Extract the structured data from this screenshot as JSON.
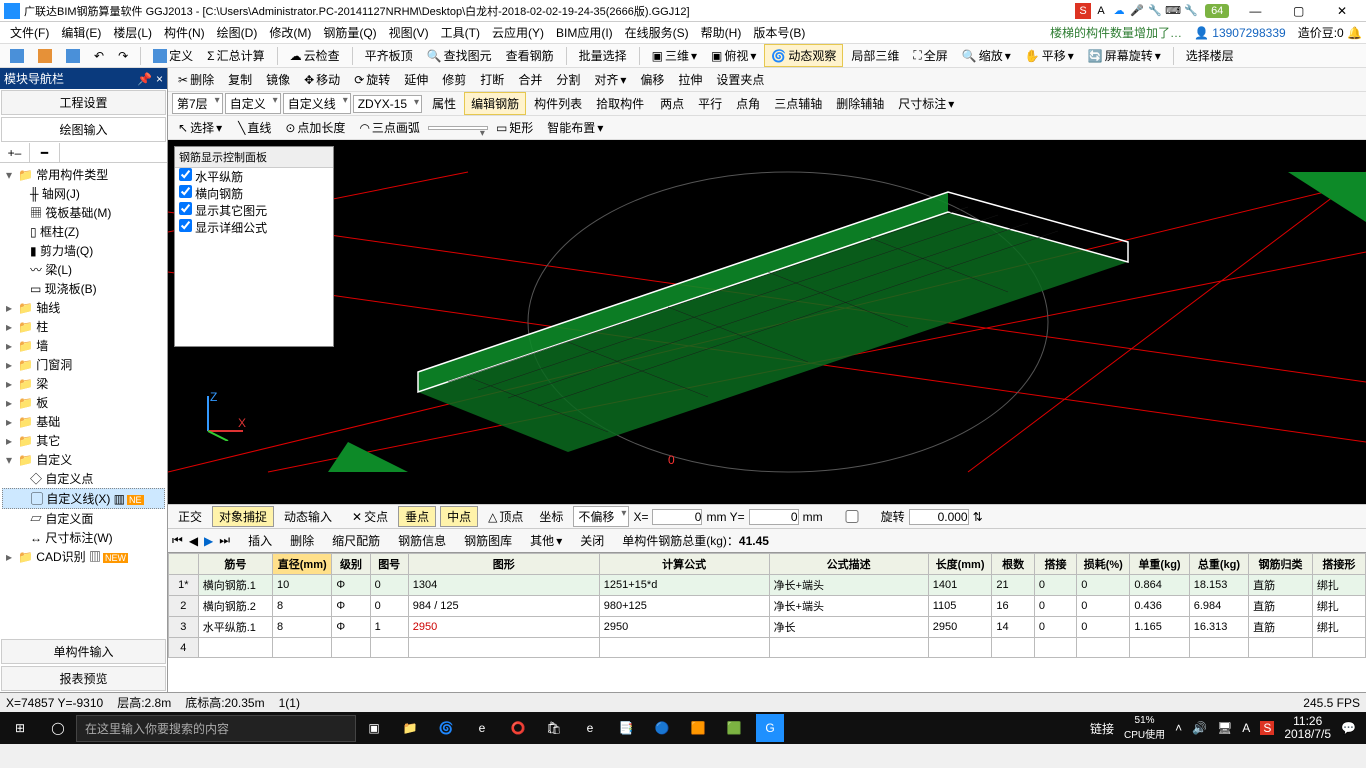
{
  "title": "广联达BIM钢筋算量软件 GGJ2013 - [C:\\Users\\Administrator.PC-20141127NRHM\\Desktop\\白龙村-2018-02-02-19-24-35(2666版).GGJ12]",
  "badge": "64",
  "window_buttons": {
    "min": "—",
    "max": "▢",
    "close": "✕"
  },
  "menu": [
    "文件(F)",
    "编辑(E)",
    "楼层(L)",
    "构件(N)",
    "绘图(D)",
    "修改(M)",
    "钢筋量(Q)",
    "视图(V)",
    "工具(T)",
    "云应用(Y)",
    "BIM应用(I)",
    "在线服务(S)",
    "帮助(H)",
    "版本号(B)"
  ],
  "menu_right": {
    "notice": "楼梯的构件数量增加了…",
    "user": "13907298339",
    "balance_label": "造价豆:",
    "balance": "0"
  },
  "toolbar1": [
    "定义",
    "汇总计算",
    "云检查",
    "平齐板顶",
    "查找图元",
    "查看钢筋",
    "批量选择",
    "三维",
    "俯视",
    "动态观察",
    "局部三维",
    "全屏",
    "缩放",
    "平移",
    "屏幕旋转",
    "选择楼层"
  ],
  "toolbar2": [
    "删除",
    "复制",
    "镜像",
    "移动",
    "旋转",
    "延伸",
    "修剪",
    "打断",
    "合并",
    "分割",
    "对齐",
    "偏移",
    "拉伸",
    "设置夹点"
  ],
  "toolbar3": {
    "floor": "第7层",
    "cat": "自定义",
    "type": "自定义线",
    "code": "ZDYX-15",
    "buttons": [
      "属性",
      "编辑钢筋",
      "构件列表",
      "拾取构件",
      "两点",
      "平行",
      "点角",
      "三点辅轴",
      "删除辅轴",
      "尺寸标注"
    ]
  },
  "toolbar4": [
    "选择",
    "直线",
    "点加长度",
    "三点画弧",
    "矩形",
    "智能布置"
  ],
  "nav": {
    "header": "模块导航栏",
    "sections": [
      "工程设置",
      "绘图输入",
      "单构件输入",
      "报表预览"
    ]
  },
  "tree": {
    "root": "常用构件类型",
    "items": [
      "轴网(J)",
      "筏板基础(M)",
      "框柱(Z)",
      "剪力墙(Q)",
      "梁(L)",
      "现浇板(B)"
    ],
    "cats": [
      "轴线",
      "柱",
      "墙",
      "门窗洞",
      "梁",
      "板",
      "基础",
      "其它"
    ],
    "custom": "自定义",
    "custom_items": [
      "自定义点",
      "自定义线(X)",
      "自定义面",
      "尺寸标注(W)"
    ],
    "cad": "CAD识别"
  },
  "ctrlpanel": {
    "title": "钢筋显示控制面板",
    "opts": [
      "水平纵筋",
      "横向钢筋",
      "显示其它图元",
      "显示详细公式"
    ]
  },
  "snapbar": {
    "items": [
      "正交",
      "对象捕捉",
      "动态输入",
      "交点",
      "垂点",
      "中点",
      "顶点",
      "坐标",
      "不偏移"
    ],
    "x_label": "X=",
    "x": "0",
    "y_label": "mm Y=",
    "y": "0",
    "unit": "mm",
    "rot_label": "旋转",
    "rot": "0.000"
  },
  "gridbar": {
    "items": [
      "插入",
      "删除",
      "缩尺配筋",
      "钢筋信息",
      "钢筋图库",
      "其他",
      "关闭"
    ],
    "weight_label": "单构件钢筋总重(kg)：",
    "weight": "41.45"
  },
  "table": {
    "headers": [
      "",
      "筋号",
      "直径(mm)",
      "级别",
      "图号",
      "图形",
      "计算公式",
      "公式描述",
      "长度(mm)",
      "根数",
      "搭接",
      "损耗(%)",
      "单重(kg)",
      "总重(kg)",
      "钢筋归类",
      "搭接形"
    ],
    "rows": [
      {
        "n": "1*",
        "name": "横向钢筋.1",
        "dia": "10",
        "lvl": "Φ",
        "pic": "0",
        "shape": "1304",
        "formula": "1251+15*d",
        "desc": "净长+端头",
        "len": "1401",
        "cnt": "21",
        "lap": "0",
        "loss": "0",
        "uw": "0.864",
        "tw": "18.153",
        "cls": "直筋",
        "lapt": "绑扎"
      },
      {
        "n": "2",
        "name": "横向钢筋.2",
        "dia": "8",
        "lvl": "Φ",
        "pic": "0",
        "shape": "984 / 125",
        "formula": "980+125",
        "desc": "净长+端头",
        "len": "1105",
        "cnt": "16",
        "lap": "0",
        "loss": "0",
        "uw": "0.436",
        "tw": "6.984",
        "cls": "直筋",
        "lapt": "绑扎"
      },
      {
        "n": "3",
        "name": "水平纵筋.1",
        "dia": "8",
        "lvl": "Φ",
        "pic": "1",
        "shape": "2950",
        "formula": "2950",
        "desc": "净长",
        "len": "2950",
        "cnt": "14",
        "lap": "0",
        "loss": "0",
        "uw": "1.165",
        "tw": "16.313",
        "cls": "直筋",
        "lapt": "绑扎"
      },
      {
        "n": "4",
        "name": "",
        "dia": "",
        "lvl": "",
        "pic": "",
        "shape": "",
        "formula": "",
        "desc": "",
        "len": "",
        "cnt": "",
        "lap": "",
        "loss": "",
        "uw": "",
        "tw": "",
        "cls": "",
        "lapt": ""
      }
    ]
  },
  "status": {
    "coord": "X=74857 Y=-9310",
    "fh": "层高:2.8m",
    "bl": "底标高:20.35m",
    "sel": "1(1)",
    "fps": "245.5 FPS"
  },
  "taskbar": {
    "search_placeholder": "在这里输入你要搜索的内容",
    "link": "链接",
    "cpu": "51%\nCPU使用",
    "time": "11:26",
    "date": "2018/7/5"
  }
}
